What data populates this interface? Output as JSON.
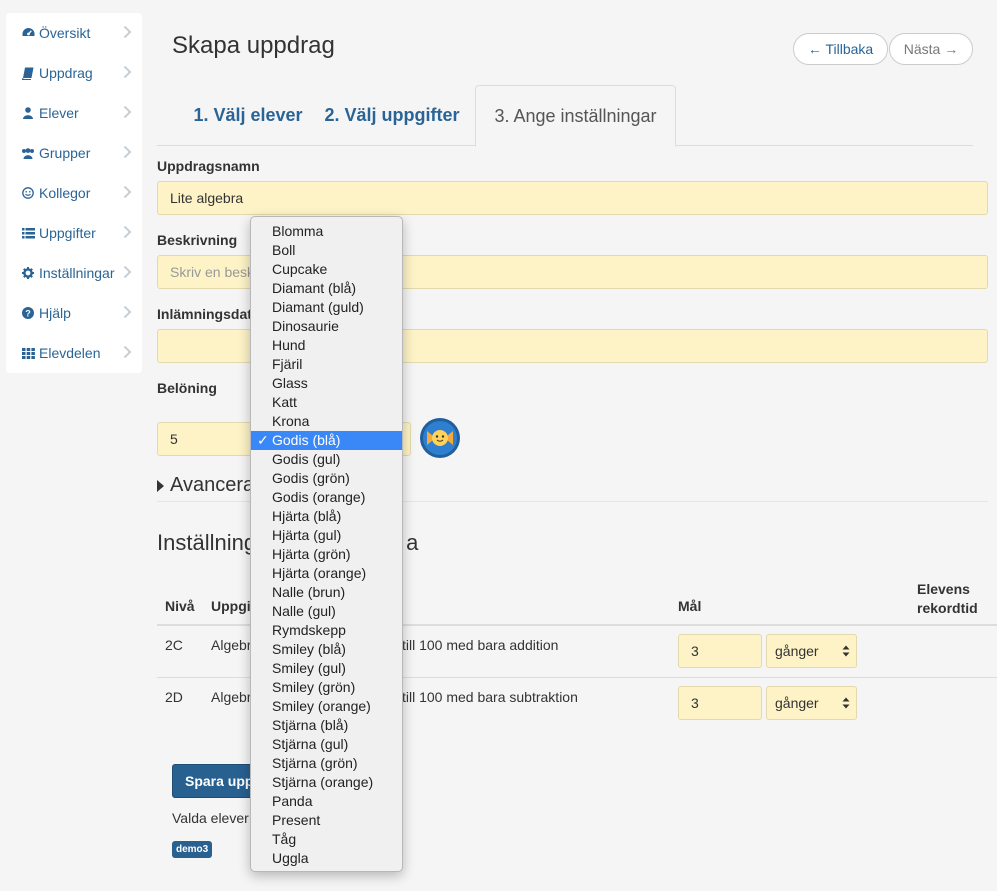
{
  "sidebar": {
    "items": [
      {
        "label": "Översikt",
        "icon": "dashboard-icon"
      },
      {
        "label": "Uppdrag",
        "icon": "book-icon"
      },
      {
        "label": "Elever",
        "icon": "user-icon"
      },
      {
        "label": "Grupper",
        "icon": "users-icon"
      },
      {
        "label": "Kollegor",
        "icon": "smiley-icon"
      },
      {
        "label": "Uppgifter",
        "icon": "list-icon"
      },
      {
        "label": "Inställningar",
        "icon": "gear-icon"
      },
      {
        "label": "Hjälp",
        "icon": "question-icon"
      },
      {
        "label": "Elevdelen",
        "icon": "grid-icon"
      }
    ]
  },
  "header": {
    "title": "Skapa uppdrag",
    "back_label": "← Tillbaka",
    "next_label": "Nästa →"
  },
  "tabs": [
    {
      "label": "1. Välj elever"
    },
    {
      "label": "2. Välj uppgifter"
    },
    {
      "label": "3. Ange inställningar"
    }
  ],
  "form": {
    "name_label": "Uppdragsnamn",
    "name_value": "Lite algebra",
    "description_label": "Beskrivning",
    "description_placeholder": "Skriv en besk",
    "due_label": "Inlämningsdat",
    "reward_label": "Belöning",
    "reward_value": "5",
    "advanced_label": "Avancera"
  },
  "settings": {
    "title": "Inställning",
    "title_suffix": "a",
    "columns": {
      "level": "Nivå",
      "task": "Uppgi",
      "goal": "Mål",
      "record": "Elevens rekordtid"
    },
    "rows": [
      {
        "level": "2C",
        "task_start": "Algebr",
        "task_end": "till 100 med bara addition",
        "goal": "3",
        "unit": "gånger"
      },
      {
        "level": "2D",
        "task_start": "Algebr",
        "task_end": "till 100 med bara subtraktion",
        "goal": "3",
        "unit": "gånger"
      }
    ]
  },
  "footer": {
    "save_label": "Spara upp",
    "chosen_label": "Valda elever",
    "badge": "demo3"
  },
  "dropdown": {
    "selected": "Godis (blå)",
    "options": [
      "Blomma",
      "Boll",
      "Cupcake",
      "Diamant (blå)",
      "Diamant (guld)",
      "Dinosaurie",
      "Hund",
      "Fjäril",
      "Glass",
      "Katt",
      "Krona",
      "Godis (blå)",
      "Godis (gul)",
      "Godis (grön)",
      "Godis (orange)",
      "Hjärta (blå)",
      "Hjärta (gul)",
      "Hjärta (grön)",
      "Hjärta (orange)",
      "Nalle (brun)",
      "Nalle (gul)",
      "Rymdskepp",
      "Smiley (blå)",
      "Smiley (gul)",
      "Smiley (grön)",
      "Smiley (orange)",
      "Stjärna (blå)",
      "Stjärna (gul)",
      "Stjärna (grön)",
      "Stjärna (orange)",
      "Panda",
      "Present",
      "Tåg",
      "Uggla"
    ]
  },
  "colors": {
    "link": "#2a6496",
    "input_bg": "#fdf3c6",
    "primary": "#286090",
    "selected_option": "#3a87f7"
  }
}
